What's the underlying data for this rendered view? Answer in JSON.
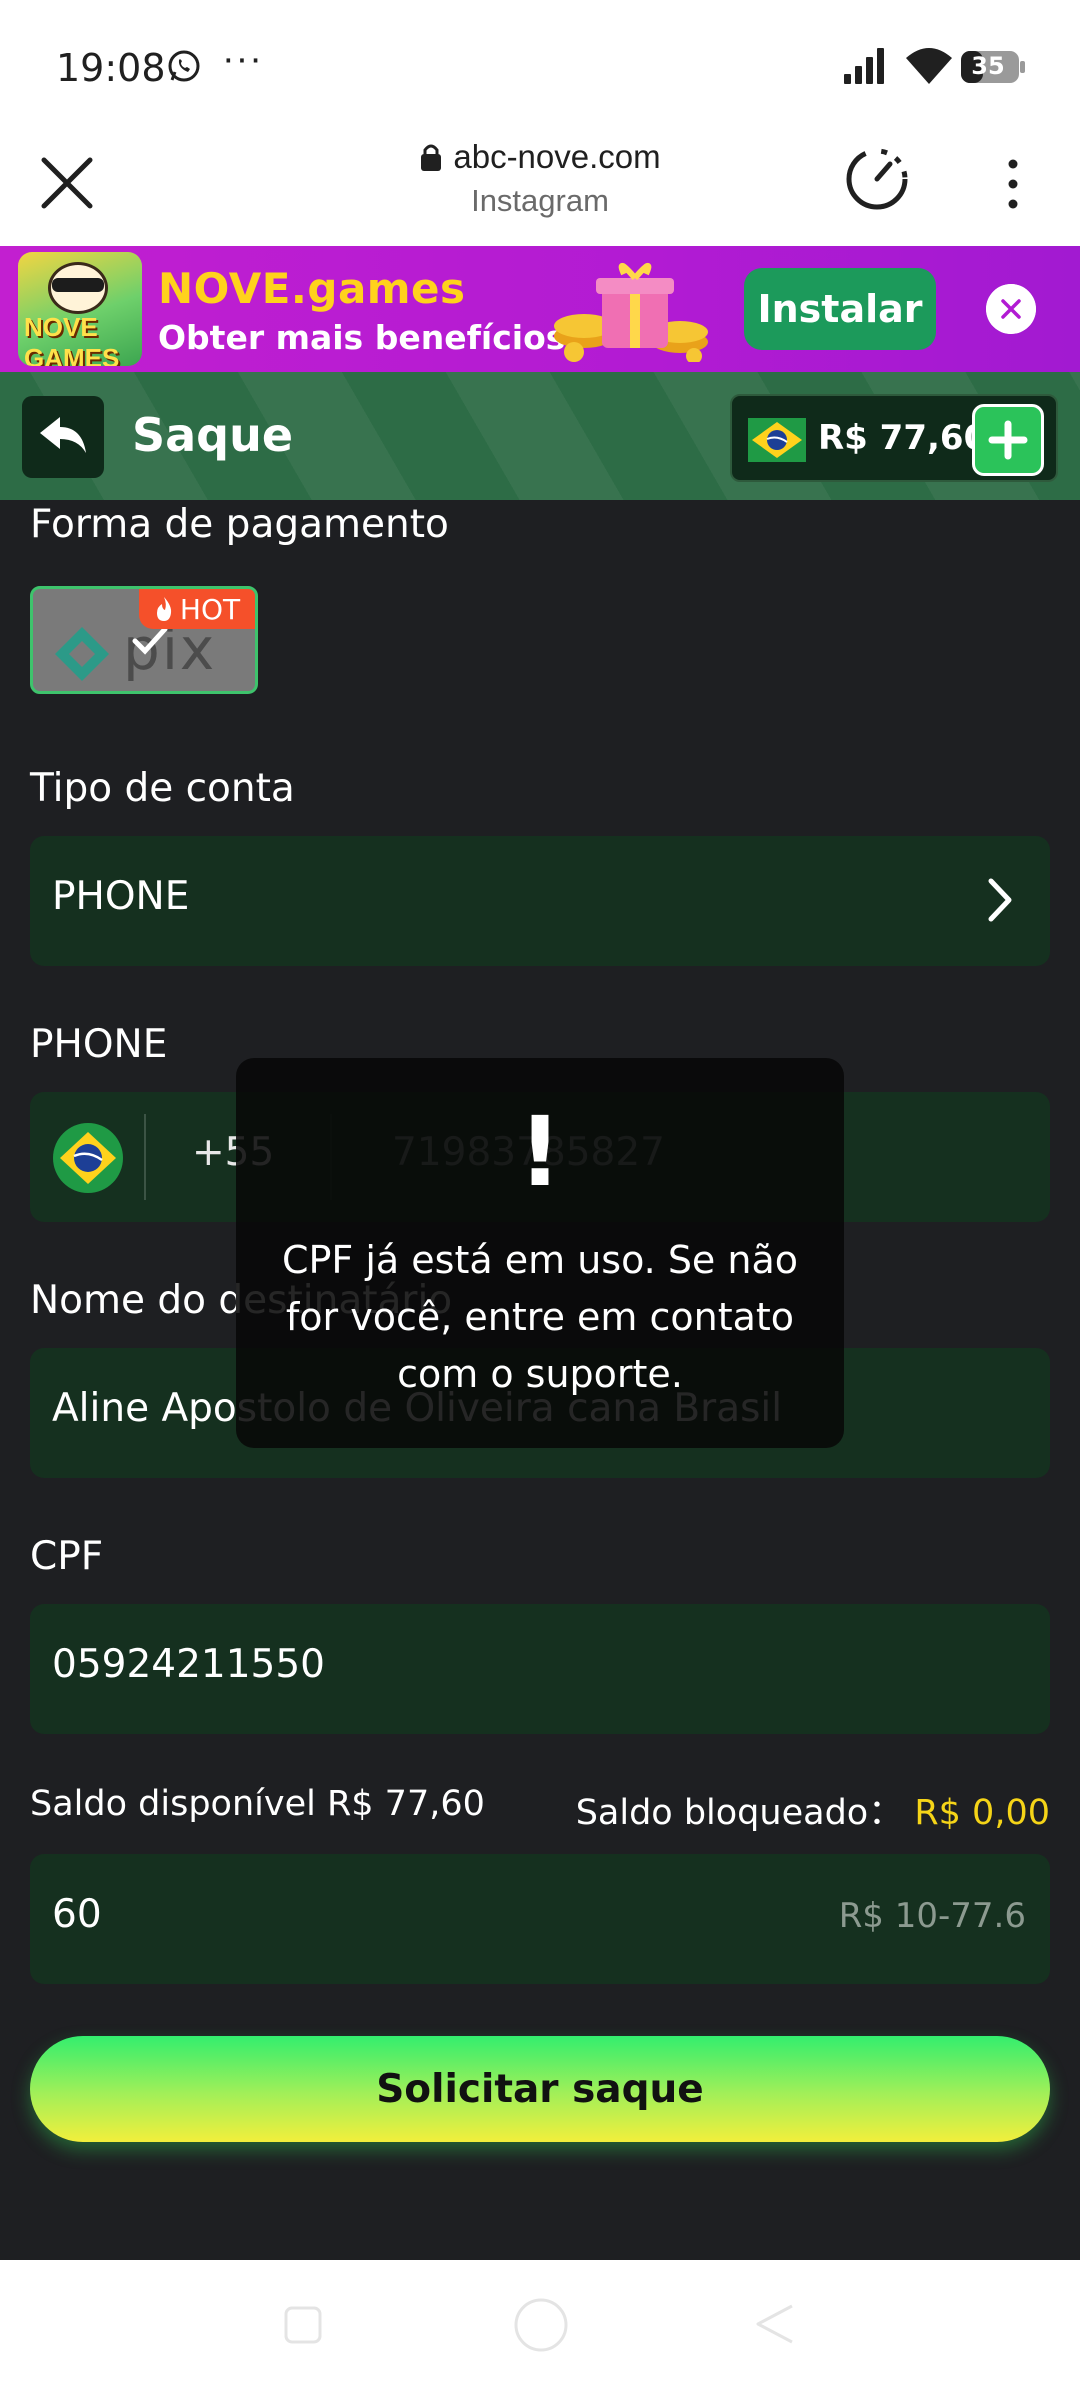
{
  "status_bar": {
    "time": "19:08",
    "more": "···",
    "battery": "35"
  },
  "browser": {
    "url": "abc-nove.com",
    "source": "Instagram"
  },
  "banner": {
    "title": "NOVE.games",
    "subtitle": "Obter mais benefícios",
    "install_label": "Instalar",
    "logo_text": "NOVE GAMES"
  },
  "header": {
    "title": "Saque",
    "balance": "R$ 77,60"
  },
  "form": {
    "payment_label": "Forma de pagamento",
    "payment_badge": "HOT",
    "payment_method": "pix",
    "account_type_label": "Tipo de conta",
    "account_type_value": "PHONE",
    "phone_label": "PHONE",
    "country_code": "+55",
    "phone_value": "71983785827",
    "name_label": "Nome do destinatário",
    "name_value": "Aline Apostolo de Oliveira cana Brasil",
    "cpf_label": "CPF",
    "cpf_value": "05924211550",
    "available_label": "Saldo disponível",
    "available_value": "R$ 77,60",
    "blocked_label": "Saldo bloqueado：",
    "blocked_value": "R$ 0,00",
    "amount_value": "60",
    "amount_range": "R$ 10-77.6",
    "submit_label": "Solicitar saque"
  },
  "toast": {
    "icon": "!",
    "message": "CPF já está em uso. Se não for você, entre em contato com o suporte."
  },
  "colors": {
    "accent_green": "#2bc35a",
    "field_bg": "#15301f",
    "page_bg": "#1e1f22",
    "banner_purple": "#b21bd3",
    "yellow": "#f5d418"
  }
}
